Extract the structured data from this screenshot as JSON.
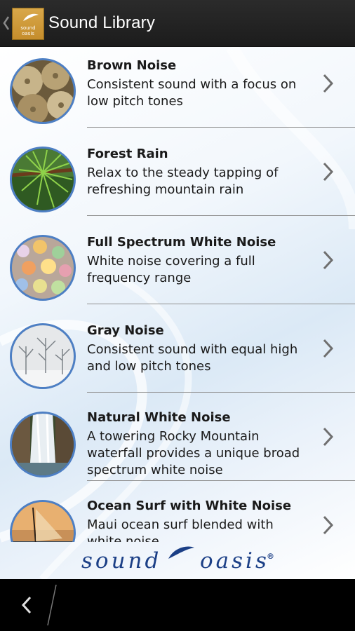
{
  "header": {
    "title": "Sound Library",
    "logo_text_line1": "sound",
    "logo_text_line2": "oasis",
    "up_icon": "chevron-left-icon"
  },
  "sounds": [
    {
      "title": "Brown Noise",
      "description": "Consistent sound with a focus on low pitch tones",
      "thumb": "sea-urchin-shells"
    },
    {
      "title": "Forest Rain",
      "description": "Relax to the steady tapping of refreshing mountain rain",
      "thumb": "pine-needles-rain"
    },
    {
      "title": "Full Spectrum White Noise",
      "description": "White noise covering a full frequency range",
      "thumb": "bokeh-lights"
    },
    {
      "title": "Gray Noise",
      "description": "Consistent sound with equal high and low pitch tones",
      "thumb": "snowy-trees"
    },
    {
      "title": "Natural White Noise",
      "description": "A towering Rocky Mountain waterfall provides a unique broad spectrum white noise",
      "thumb": "waterfall"
    },
    {
      "title": "Ocean Surf with White Noise",
      "description": "Maui ocean surf blended with white noise",
      "thumb": "sailboat-sunset"
    }
  ],
  "footer": {
    "brand_word1": "sound",
    "brand_word2": "oasis",
    "registered": "®"
  },
  "navbar": {
    "back_icon": "back-icon"
  },
  "colors": {
    "accent_blue": "#4d7fc4",
    "brand_blue": "#1b3f86",
    "logo_gold": "#d9a84a"
  }
}
